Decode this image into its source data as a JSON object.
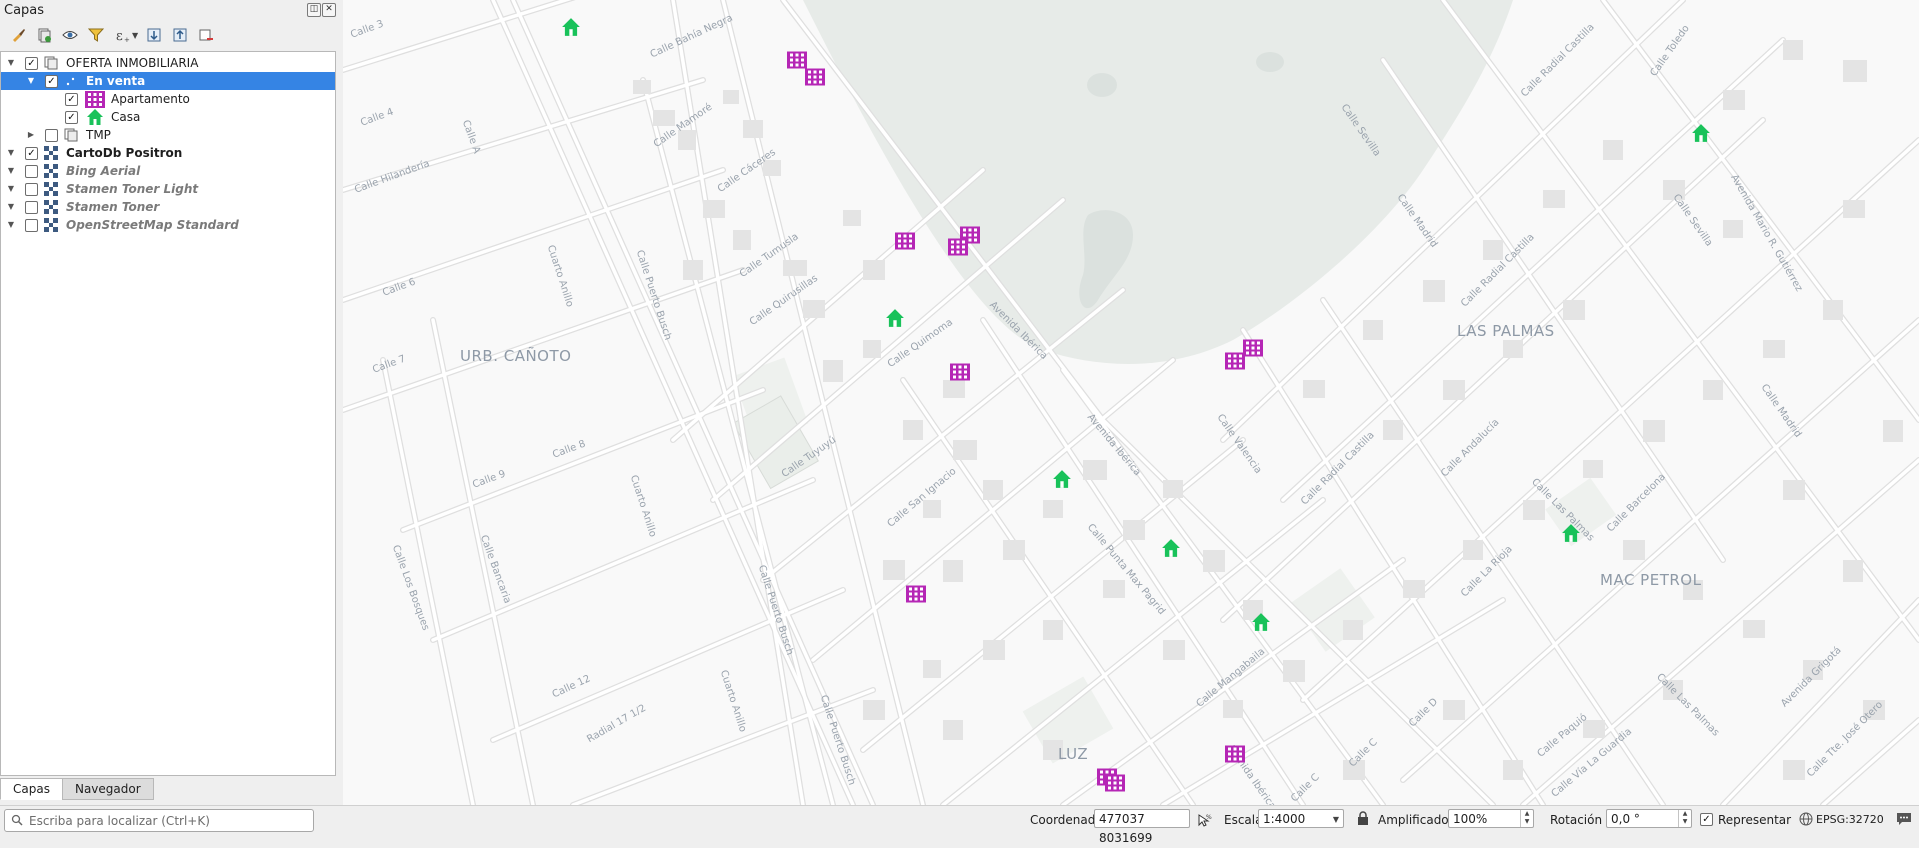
{
  "panel": {
    "title": "Capas",
    "layers": [
      {
        "name": "OFERTA INMOBILIARIA",
        "checked": true,
        "expanded": true,
        "type": "group"
      },
      {
        "name": "En venta",
        "checked": true,
        "expanded": true,
        "type": "vector-point",
        "selected": true
      },
      {
        "name": "Apartamento",
        "checked": true,
        "type": "category",
        "icon": "apartment-icon"
      },
      {
        "name": "Casa",
        "checked": true,
        "type": "category",
        "icon": "house-icon"
      },
      {
        "name": "TMP",
        "checked": false,
        "expanded": false,
        "type": "group"
      },
      {
        "name": "CartoDb Positron",
        "checked": true,
        "type": "raster"
      },
      {
        "name": "Bing Aerial",
        "checked": false,
        "type": "raster"
      },
      {
        "name": "Stamen Toner Light",
        "checked": false,
        "type": "raster"
      },
      {
        "name": "Stamen Toner",
        "checked": false,
        "type": "raster"
      },
      {
        "name": "OpenStreetMap Standard",
        "checked": false,
        "type": "raster"
      }
    ],
    "tabs": [
      "Capas",
      "Navegador"
    ],
    "active_tab": "Capas"
  },
  "map": {
    "districts": [
      "URB. CAÑOTO",
      "LAS PALMAS",
      "MAC PETROL",
      "LUZ"
    ],
    "streets": [
      "Calle 3",
      "Calle 4",
      "Calle Hilandería",
      "Calle A",
      "Calle 6",
      "Calle 7",
      "Calle 8",
      "Calle 9",
      "Calle Los Bosques",
      "Calle Bancaria",
      "Calle 12",
      "Radial 17 1/2",
      "Cuarto Anillo",
      "Calle Bahía Negra",
      "Calle Mamoré",
      "Calle Cáceres",
      "Calle Puerto Busch",
      "Calle Tumusla",
      "Calle Quirusillas",
      "Calle Tuyuyú",
      "Calle Quimoma",
      "Avenida Ibérica",
      "Calle San Ignacio",
      "Calle Punta Max Pagrid",
      "Calle Valencia",
      "Calle Radial Castilla",
      "Calle Mangabaila",
      "Calle Madrid",
      "Calle Sevilla",
      "Calle Toledo",
      "Avenida Mario R. Gutiérrez",
      "Calle La Rioja",
      "Calle Andalucía",
      "Calle Las Palmas",
      "Calle Barcelona",
      "Avenida Grigotá",
      "Calle Paquió",
      "Calle Vía La Guardia",
      "Calle Tte. José Otero",
      "Calle D",
      "Calle C"
    ],
    "markers": {
      "apartment_color": "#b526b5",
      "house_color": "#19c25a"
    }
  },
  "status": {
    "locator_placeholder": "Escriba para localizar (Ctrl+K)",
    "coord_label": "Coordenada",
    "coord_value": "477037 8031699",
    "scale_label": "Escala",
    "scale_value": "1:4000",
    "magnifier_label": "Amplificador",
    "magnifier_value": "100%",
    "rotation_label": "Rotación",
    "rotation_value": "0,0 °",
    "render_label": "Representar",
    "render_checked": true,
    "crs": "EPSG:32720"
  }
}
